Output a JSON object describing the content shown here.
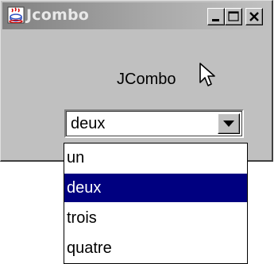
{
  "window": {
    "title": "Jcombo",
    "icon": "java-cup-icon",
    "controls": [
      "minimize-icon",
      "maximize-icon",
      "close-icon"
    ]
  },
  "label": {
    "text": "JCombo"
  },
  "combo": {
    "selected": "deux",
    "arrow_icon": "triangle-down-icon",
    "options": [
      "un",
      "deux",
      "trois",
      "quatre"
    ],
    "highlighted_index": 1
  },
  "colors": {
    "highlight": "#000080",
    "window_bg": "#c0c0c0"
  }
}
